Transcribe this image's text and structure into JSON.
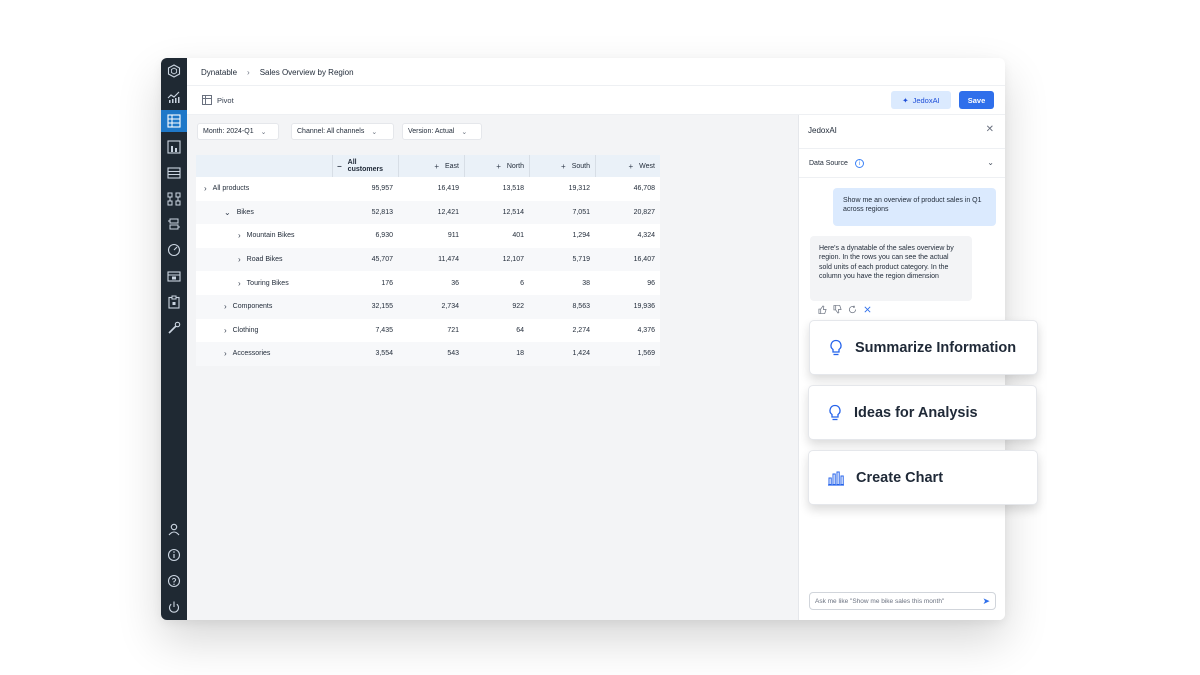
{
  "breadcrumb": {
    "root": "Dynatable",
    "separator": "›",
    "page": "Sales Overview by Region"
  },
  "toolbar": {
    "pivot_label": "Pivot",
    "jedox_label": "JedoxAI",
    "save_label": "Save",
    "more": "⋮"
  },
  "filters": [
    {
      "label": "Month: 2024-Q1"
    },
    {
      "label": "Channel: All channels"
    },
    {
      "label": "Version: Actual"
    }
  ],
  "table": {
    "headers": [
      "All customers",
      "East",
      "North",
      "South",
      "West"
    ],
    "header_markers": [
      "−",
      "+",
      "+",
      "+",
      "+"
    ],
    "rows": [
      {
        "expander": "›",
        "label": "All products",
        "values": [
          "95,957",
          "16,419",
          "13,518",
          "19,312",
          "46,708"
        ]
      },
      {
        "expander": "⌄",
        "label": "Bikes",
        "values": [
          "52,813",
          "12,421",
          "12,514",
          "7,051",
          "20,827"
        ]
      },
      {
        "expander": "›",
        "label": "Mountain Bikes",
        "values": [
          "6,930",
          "911",
          "401",
          "1,294",
          "4,324"
        ]
      },
      {
        "expander": "›",
        "label": "Road Bikes",
        "values": [
          "45,707",
          "11,474",
          "12,107",
          "5,719",
          "16,407"
        ]
      },
      {
        "expander": "›",
        "label": "Touring Bikes",
        "values": [
          "176",
          "36",
          "6",
          "38",
          "96"
        ]
      },
      {
        "expander": "›",
        "label": "Components",
        "values": [
          "32,155",
          "2,734",
          "922",
          "8,563",
          "19,936"
        ]
      },
      {
        "expander": "›",
        "label": "Clothing",
        "values": [
          "7,435",
          "721",
          "64",
          "2,274",
          "4,376"
        ]
      },
      {
        "expander": "›",
        "label": "Accessories",
        "values": [
          "3,554",
          "543",
          "18",
          "1,424",
          "1,569"
        ]
      }
    ]
  },
  "panel": {
    "title": "JedoxAI",
    "close": "✕",
    "data_source_label": "Data Source",
    "info": "i",
    "chevron": "⌄",
    "user_message": "Show me an overview of product sales in Q1 across regions",
    "ai_message": "Here's a dynatable of the sales overview by region. In the rows you can see the actual sold units of each product category. In the column you have the region dimension",
    "action_icons": [
      "thumbs-up-icon",
      "thumbs-down-icon",
      "refresh-icon",
      "close-icon"
    ],
    "ask_placeholder": "Ask me like \"Show me bike sales this month\"",
    "send": "➤"
  },
  "cards": [
    {
      "label": "Summarize Information",
      "icon": "lightbulb-icon"
    },
    {
      "label": "Ideas for Analysis",
      "icon": "lightbulb-icon"
    },
    {
      "label": "Create Chart",
      "icon": "bar-chart-icon"
    }
  ],
  "colors": {
    "rail": "#1f2933",
    "accent": "#2f6feb",
    "active_rail": "#1f78c8",
    "header_row": "#eaf1f8"
  }
}
